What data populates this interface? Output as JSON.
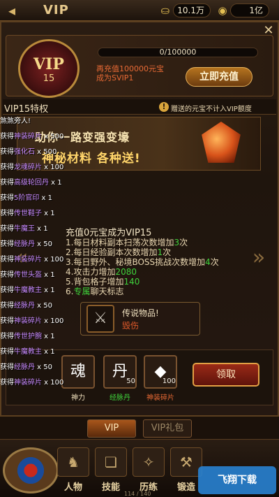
{
  "topbar": {
    "title": "VIP",
    "ingot_amount": "10.1万",
    "gold_amount": "1亿",
    "back_icon": "back-arrow-icon",
    "ingot_icon": "ingot-icon",
    "gold_icon": "coin-icon"
  },
  "vip_panel": {
    "badge_label": "VIP",
    "badge_level": "15",
    "progress_text": "0/100000",
    "progress_fraction": 0,
    "recharge_line1": "再充值100000元宝",
    "recharge_line2": "成为SVIP1",
    "recharge_button": "立即充值",
    "accent": "#e86a35"
  },
  "privilege": {
    "title": "VIP15特权",
    "notice": "赠送的元宝不计入VIP额度"
  },
  "banner": {
    "line1": "助你一路变强变壕",
    "line2": "神秘材料 各种送!"
  },
  "detail": {
    "title": "充值0元宝成为VIP15",
    "perks": [
      {
        "prefix": "1.每日材料副本扫荡次数增加",
        "value": "3",
        "suffix": "次"
      },
      {
        "prefix": "2.每日经验副本次数增加",
        "value": "1",
        "suffix": "次"
      },
      {
        "prefix": "3.每日野外、秘境BOSS挑战次数增加",
        "value": "4",
        "suffix": "次"
      },
      {
        "prefix": "4.攻击力增加",
        "value": "2080",
        "suffix": ""
      },
      {
        "prefix": "5.背包格子增加",
        "value": "140",
        "suffix": ""
      },
      {
        "prefix": "6.",
        "value": "专属",
        "suffix": "聊天标志"
      }
    ]
  },
  "legendary": {
    "title": "传说物品!",
    "item": "毁伤"
  },
  "rewards": [
    {
      "label": "",
      "count": "",
      "glyph": "✦"
    },
    {
      "label": "神力",
      "count": "",
      "glyph": "魂"
    },
    {
      "label": "经脉丹",
      "count": "50",
      "glyph": "丹"
    },
    {
      "label": "神装碎片",
      "count": "100",
      "glyph": "◆"
    }
  ],
  "claim_button": "领取",
  "chat_log": [
    {
      "pre": "煞煞旁人!",
      "item": "",
      "suffix": ""
    },
    {
      "pre": "获得",
      "item": "神装碎片",
      "suffix": " x 500"
    },
    {
      "pre": "获得",
      "item": "强化石",
      "suffix": " x 500"
    },
    {
      "pre": "获得",
      "item": "龙魂碎片",
      "suffix": " x 100"
    },
    {
      "pre": "获得",
      "item": "高级轮回丹",
      "suffix": " x 1"
    },
    {
      "pre": "获得",
      "item": "5阶官印",
      "suffix": " x 1"
    },
    {
      "pre": "获得",
      "item": "传世鞋子",
      "suffix": " x 1"
    },
    {
      "pre": "获得",
      "item": "牛魔王",
      "suffix": " x 1"
    },
    {
      "pre": "获得",
      "item": "经脉丹",
      "suffix": " x 50"
    },
    {
      "pre": "获得",
      "item": "神装碎片",
      "suffix": " x 100"
    },
    {
      "pre": "获得",
      "item": "传世头盔",
      "suffix": " x 1"
    },
    {
      "pre": "获得",
      "item": "牛魔教主",
      "suffix": " x 1"
    },
    {
      "pre": "获得",
      "item": "经脉丹",
      "suffix": " x 50"
    },
    {
      "pre": "获得",
      "item": "神装碎片",
      "suffix": " x 100"
    },
    {
      "pre": "获得",
      "item": "传世护腕",
      "suffix": " x 1"
    },
    {
      "pre": "获得",
      "item": "牛魔教主",
      "suffix": " x 1"
    },
    {
      "pre": "获得",
      "item": "经脉丹",
      "suffix": " x 50"
    },
    {
      "pre": "获得",
      "item": "神装碎片",
      "suffix": " x 100"
    }
  ],
  "tabs": [
    {
      "label": "VIP",
      "active": true
    },
    {
      "label": "VIP礼包",
      "active": false
    }
  ],
  "nav": [
    {
      "label": "人物"
    },
    {
      "label": "技能"
    },
    {
      "label": "历练"
    },
    {
      "label": "锻造"
    }
  ],
  "watermark": "飞翔下载",
  "frame_counter": "114 / 140"
}
